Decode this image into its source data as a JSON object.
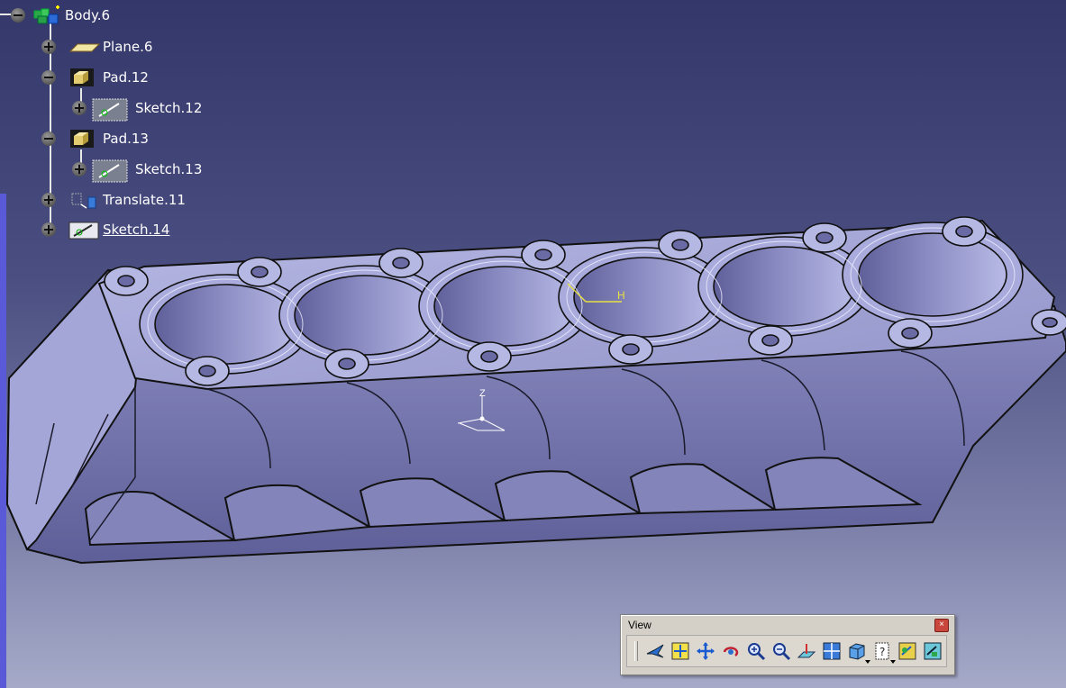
{
  "tree": {
    "root": {
      "label": "Body.6",
      "icon": "body-icon"
    },
    "items": [
      {
        "label": "Plane.6",
        "icon": "plane-icon"
      },
      {
        "label": "Pad.12",
        "icon": "pad-icon"
      },
      {
        "label": "Sketch.12",
        "icon": "sketch-icon"
      },
      {
        "label": "Pad.13",
        "icon": "pad-icon"
      },
      {
        "label": "Sketch.13",
        "icon": "sketch-icon"
      },
      {
        "label": "Translate.11",
        "icon": "translate-icon"
      },
      {
        "label": "Sketch.14",
        "icon": "sketch-icon"
      }
    ]
  },
  "compass": {
    "z_label": "Z",
    "h_label": "H"
  },
  "view_toolbar": {
    "title": "View",
    "close_symbol": "×",
    "buttons": [
      "fly-mode-icon",
      "fit-all-in-icon",
      "pan-icon",
      "rotate-icon",
      "zoom-in-icon",
      "zoom-out-icon",
      "normal-view-icon",
      "multi-view-icon",
      "isometric-view-icon",
      "hide-show-icon",
      "swap-visible-space-icon",
      "shading-icon"
    ]
  },
  "colors": {
    "background_top": "#34376a",
    "background_bottom": "#a6aac8",
    "part_face": "#9b9ccf",
    "part_shadow": "#6f70a8",
    "part_highlight": "#c4c6ec",
    "tree_text": "#ffffff"
  }
}
